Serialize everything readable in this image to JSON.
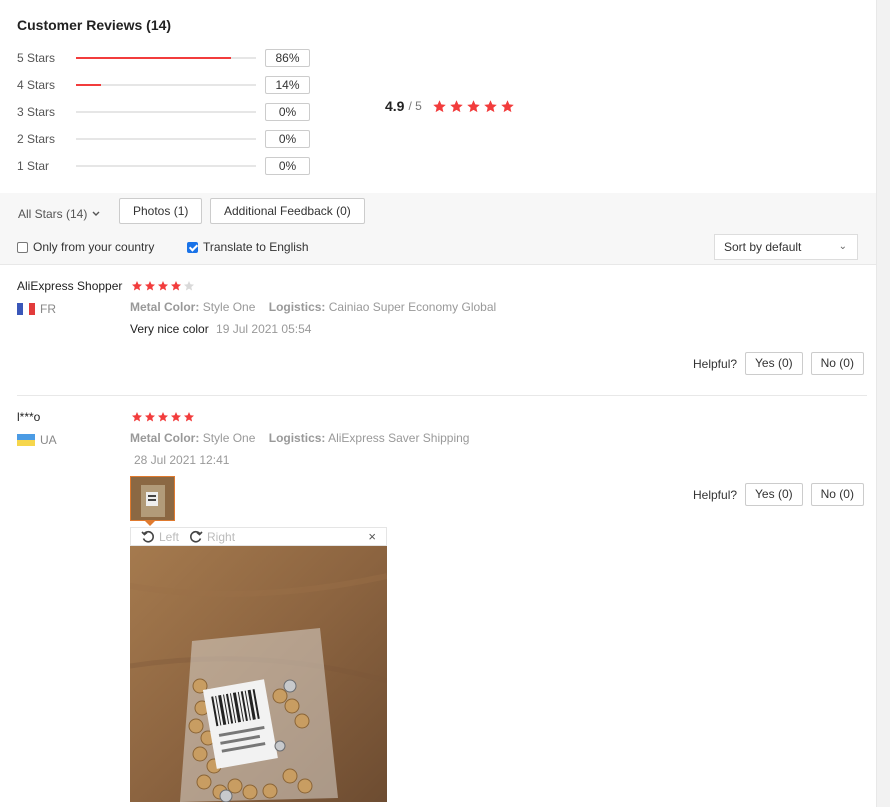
{
  "header": {
    "title": "Customer Reviews (14)"
  },
  "distribution": [
    {
      "label": "5 Stars",
      "percent": "86%",
      "fill": 0.86
    },
    {
      "label": "4 Stars",
      "percent": "14%",
      "fill": 0.14
    },
    {
      "label": "3 Stars",
      "percent": "0%",
      "fill": 0
    },
    {
      "label": "2 Stars",
      "percent": "0%",
      "fill": 0
    },
    {
      "label": "1 Star",
      "percent": "0%",
      "fill": 0
    }
  ],
  "average": {
    "score": "4.9",
    "out_of": "/ 5",
    "stars": 5
  },
  "filters": {
    "all_stars": "All Stars (14)",
    "photos": "Photos (1)",
    "additional": "Additional Feedback (0)",
    "only_country": "Only from your country",
    "only_country_checked": false,
    "translate": "Translate to English",
    "translate_checked": true,
    "sort": "Sort by default"
  },
  "reviews": [
    {
      "name": "AliExpress Shopper",
      "country": "FR",
      "flag": "france-flag",
      "stars": 4,
      "attr1_label": "Metal Color:",
      "attr1_value": "Style One",
      "attr2_label": "Logistics:",
      "attr2_value": "Cainiao Super Economy Global",
      "text": "Very nice color",
      "date": "19 Jul 2021 05:54",
      "helpful": "Helpful?",
      "yes": "Yes (0)",
      "no": "No (0)"
    },
    {
      "name": "l***o",
      "country": "UA",
      "flag": "ukraine-flag",
      "stars": 5,
      "attr1_label": "Metal Color:",
      "attr1_value": "Style One",
      "attr2_label": "Logistics:",
      "attr2_value": "AliExpress Saver Shipping",
      "text": "",
      "date": "28 Jul 2021 12:41",
      "helpful": "Helpful?",
      "yes": "Yes (0)",
      "no": "No (0)"
    }
  ],
  "viewer": {
    "left": "Left",
    "right": "Right",
    "close": "×"
  },
  "colors": {
    "star": "#f23c3c",
    "star_empty": "#d9d9d9",
    "bar": "#f23c3c",
    "accent": "#e07a2e",
    "checkbox": "#1a73e8"
  }
}
